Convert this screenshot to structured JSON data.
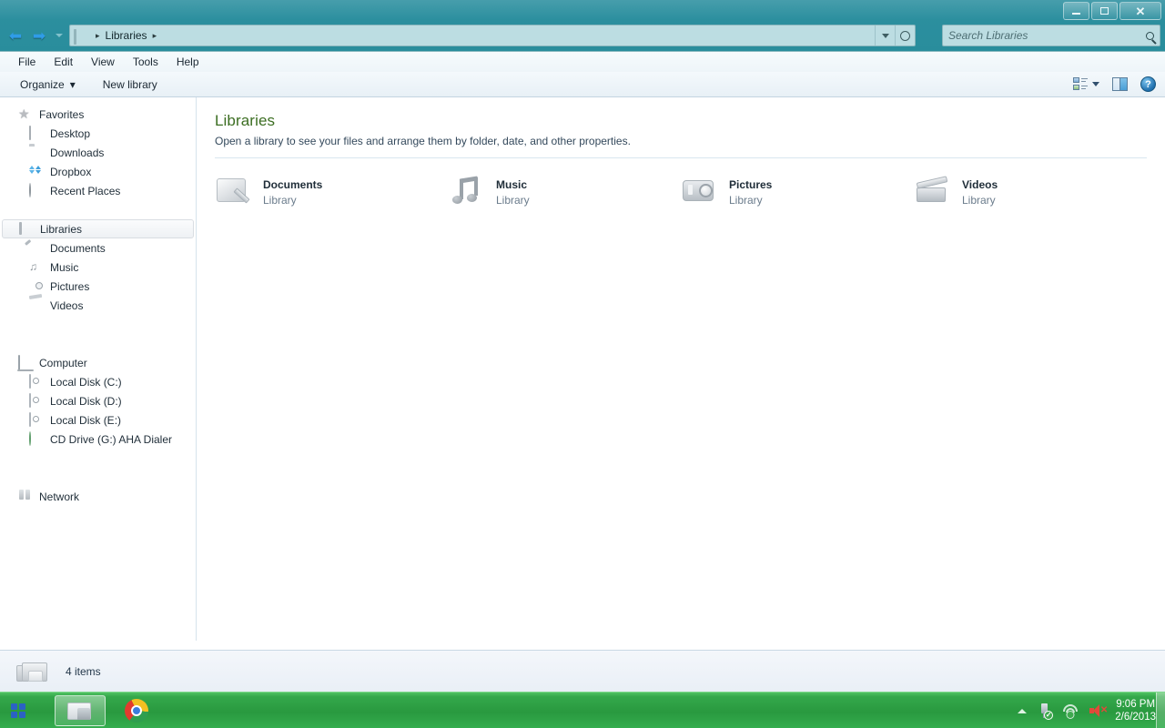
{
  "window": {
    "controls": {
      "minimize": "Minimize",
      "maximize": "Maximize",
      "close": "Close"
    }
  },
  "address": {
    "back_label": "Back",
    "forward_label": "Forward",
    "recent_label": "Recent pages",
    "icon": "libraries-icon",
    "crumbs": [
      "Libraries"
    ],
    "separator": "▸",
    "dropdown_label": "Previous locations",
    "refresh_label": "Refresh"
  },
  "search": {
    "placeholder": "Search Libraries",
    "value": "",
    "icon": "search-icon"
  },
  "menubar": {
    "items": [
      "File",
      "Edit",
      "View",
      "Tools",
      "Help"
    ]
  },
  "toolbar": {
    "organize_label": "Organize",
    "organize_caret": "▾",
    "new_library_label": "New library",
    "view_options_label": "Change your view",
    "preview_pane_label": "Show the preview pane",
    "help_label": "?"
  },
  "sidebar": {
    "groups": [
      {
        "header": {
          "label": "Favorites",
          "icon": "star-icon"
        },
        "items": [
          {
            "label": "Desktop",
            "icon": "desktop-icon"
          },
          {
            "label": "Downloads",
            "icon": "folder-icon"
          },
          {
            "label": "Dropbox",
            "icon": "dropbox-icon"
          },
          {
            "label": "Recent Places",
            "icon": "recent-places-icon"
          }
        ]
      },
      {
        "header": {
          "label": "Libraries",
          "icon": "libraries-icon",
          "selected": true
        },
        "items": [
          {
            "label": "Documents",
            "icon": "documents-library-icon"
          },
          {
            "label": "Music",
            "icon": "music-library-icon"
          },
          {
            "label": "Pictures",
            "icon": "pictures-library-icon"
          },
          {
            "label": "Videos",
            "icon": "videos-library-icon"
          }
        ]
      },
      {
        "header": {
          "label": "Computer",
          "icon": "computer-icon"
        },
        "items": [
          {
            "label": "Local Disk (C:)",
            "icon": "hard-drive-icon"
          },
          {
            "label": "Local Disk (D:)",
            "icon": "hard-drive-icon"
          },
          {
            "label": "Local Disk (E:)",
            "icon": "hard-drive-icon"
          },
          {
            "label": "CD Drive (G:) AHA Dialer",
            "icon": "cd-drive-icon"
          }
        ]
      },
      {
        "header": {
          "label": "Network",
          "icon": "network-icon"
        },
        "items": []
      }
    ]
  },
  "content": {
    "title": "Libraries",
    "title_color": "#3c6e22",
    "subtitle": "Open a library to see your files and arrange them by folder, date, and other properties.",
    "tiles": [
      {
        "name": "Documents",
        "sub": "Library",
        "icon": "documents-library-icon"
      },
      {
        "name": "Music",
        "sub": "Library",
        "icon": "music-library-icon"
      },
      {
        "name": "Pictures",
        "sub": "Library",
        "icon": "pictures-library-icon"
      },
      {
        "name": "Videos",
        "sub": "Library",
        "icon": "videos-library-icon"
      }
    ]
  },
  "statusbar": {
    "text": "4 items",
    "icon": "libraries-icon"
  },
  "taskbar": {
    "start_label": "Start",
    "buttons": [
      {
        "label": "Windows Explorer",
        "icon": "folder-icon",
        "active": true
      },
      {
        "label": "Google Chrome",
        "icon": "chrome-icon",
        "active": false
      }
    ],
    "tray": {
      "show_hidden_label": "Show hidden icons",
      "usb_label": "Safely Remove Hardware and Eject Media",
      "network_label": "Network access",
      "volume_label": "Volume muted",
      "time": "9:06 PM",
      "date": "2/6/2013",
      "show_desktop_label": "Show desktop"
    }
  },
  "theme": {
    "frame": "#17808c",
    "taskbar": "#29993f",
    "accent_green": "#3c6e22",
    "nav_arrow": "#2f9ce8"
  }
}
